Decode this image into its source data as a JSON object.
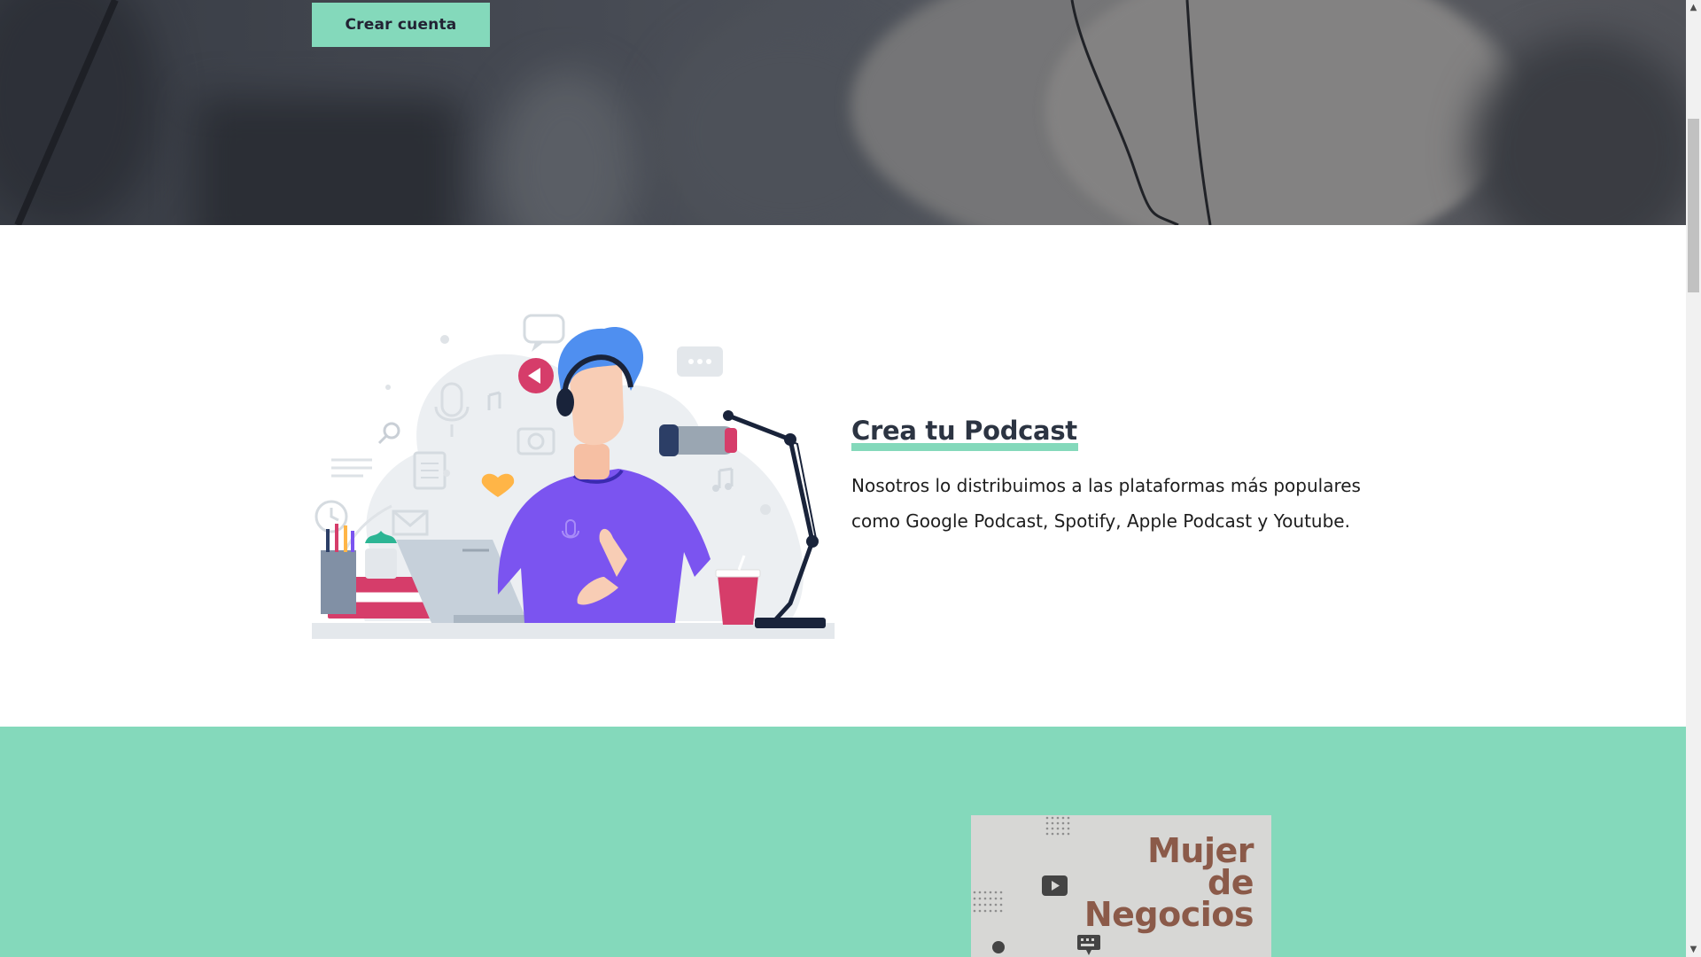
{
  "hero": {
    "create_account_label": "Crear cuenta"
  },
  "podcast": {
    "title": "Crea tu Podcast",
    "description": "Nosotros lo distribuimos a las plataformas más populares como Google Podcast, Spotify, Apple Podcast y Youtube."
  },
  "featured": {
    "card_title": "Mujer\nde\nNegocios"
  },
  "colors": {
    "accent": "#84d9bb",
    "heading": "#2c3442",
    "card_title": "#8b5a49",
    "shirt": "#7b54f0",
    "hair": "#4f8ff0"
  },
  "icons": [
    "play-icon",
    "microphone-icon",
    "camera-icon",
    "clock-icon",
    "mail-icon",
    "heart-icon",
    "search-icon",
    "chat-bubble-icon",
    "music-note-icon",
    "youtube-play-icon",
    "keyboard-icon"
  ]
}
